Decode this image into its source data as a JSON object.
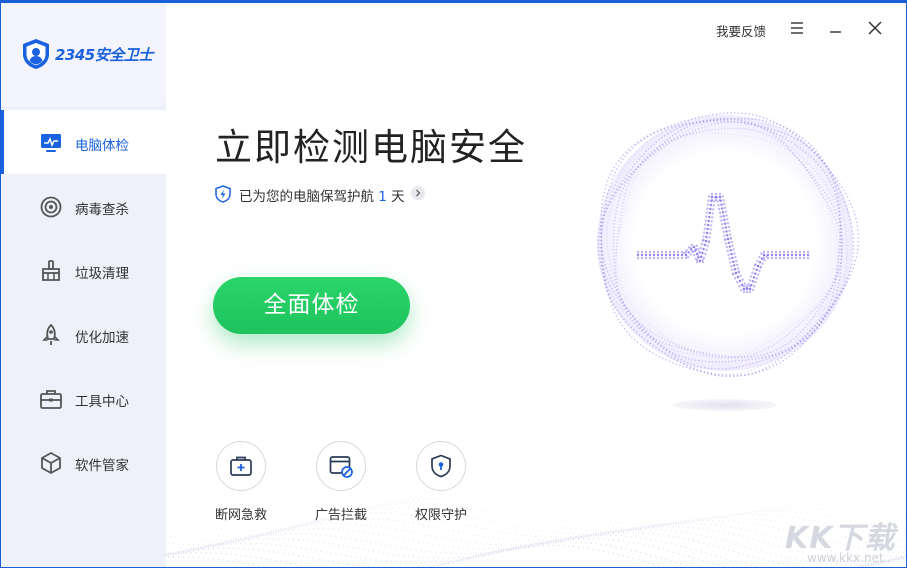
{
  "app": {
    "logo_text": "2345安全卫士"
  },
  "titlebar": {
    "feedback_label": "我要反馈",
    "menu_icon": "menu-icon",
    "minimize_icon": "minimize-icon",
    "close_icon": "close-icon"
  },
  "sidebar": {
    "items": [
      {
        "label": "电脑体检",
        "icon": "monitor-icon",
        "active": true
      },
      {
        "label": "病毒查杀",
        "icon": "target-icon",
        "active": false
      },
      {
        "label": "垃圾清理",
        "icon": "broom-icon",
        "active": false
      },
      {
        "label": "优化加速",
        "icon": "rocket-icon",
        "active": false
      },
      {
        "label": "工具中心",
        "icon": "toolbox-icon",
        "active": false
      },
      {
        "label": "软件管家",
        "icon": "cube-icon",
        "active": false
      }
    ]
  },
  "main": {
    "title": "立即检测电脑安全",
    "protect_prefix": "已为您的电脑保驾护航 ",
    "protect_days": "1",
    "protect_suffix": " 天",
    "scan_button": "全面体检",
    "tools": [
      {
        "label": "断网急救",
        "icon": "first-aid-icon"
      },
      {
        "label": "广告拦截",
        "icon": "ad-block-icon"
      },
      {
        "label": "权限守护",
        "icon": "shield-lock-icon"
      }
    ]
  },
  "watermark": {
    "text": "KK下载",
    "url": "www.kkx.net"
  },
  "colors": {
    "accent": "#1b62e0",
    "scan_green": "#1ec35d",
    "orb_purple": "#8b7cf0"
  }
}
